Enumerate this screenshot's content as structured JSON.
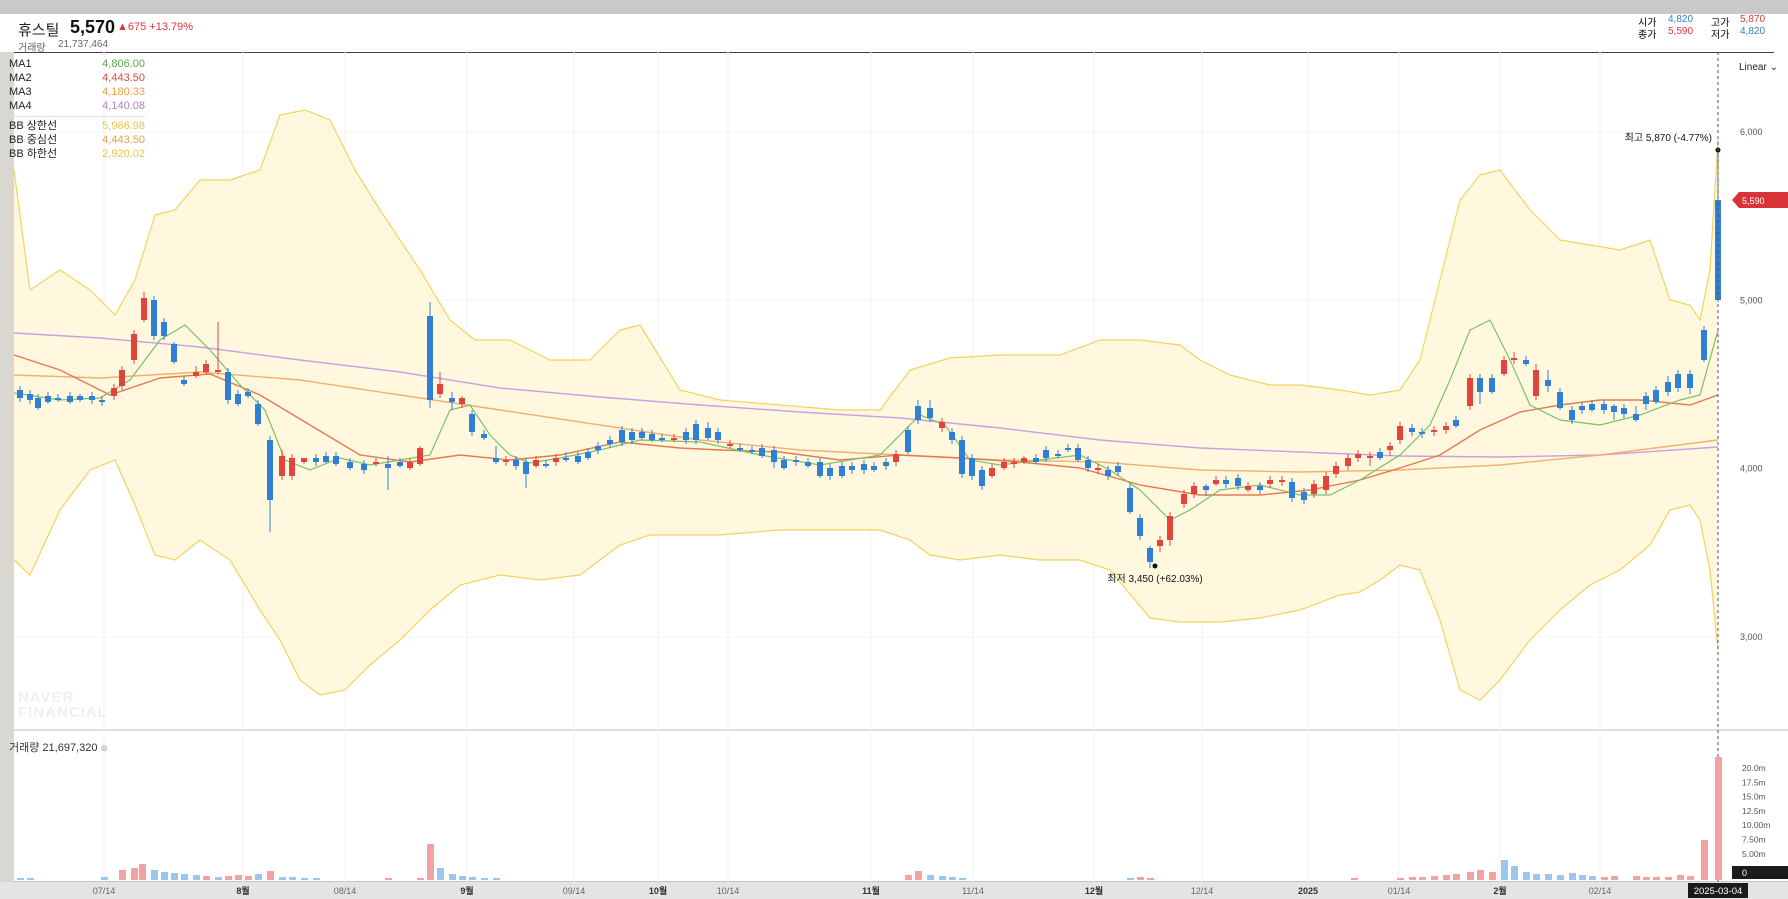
{
  "stock": {
    "name": "휴스틸",
    "price": "5,570",
    "change": "▲675 +13.79%",
    "volume_label": "거래량",
    "volume": "21,737,464"
  },
  "ohlc": {
    "open_label": "시가",
    "open": "4,820",
    "high_label": "고가",
    "high": "5,870",
    "close_label": "종가",
    "close": "5,590",
    "low_label": "저가",
    "low": "4,820"
  },
  "legend": {
    "ma": [
      {
        "name": "MA1",
        "value": "4,806.00",
        "color": "#5aaa4e"
      },
      {
        "name": "MA2",
        "value": "4,443.50",
        "color": "#e04848"
      },
      {
        "name": "MA3",
        "value": "4,180.33",
        "color": "#f0a040"
      },
      {
        "name": "MA4",
        "value": "4,140.08",
        "color": "#b080d0"
      }
    ],
    "bb": [
      {
        "name": "BB 상한선",
        "value": "5,966.98",
        "color": "#e8c54a"
      },
      {
        "name": "BB 중심선",
        "value": "4,443.50",
        "color": "#e8a040"
      },
      {
        "name": "BB 하한선",
        "value": "2,920.02",
        "color": "#e8c54a"
      }
    ]
  },
  "scale_mode": "Linear",
  "watermark": [
    "NAVER",
    "FINANCIAL"
  ],
  "volume_pane": {
    "label": "거래량 21,697,320"
  },
  "annotations": {
    "high": "최고 5,870 (-4.77%)",
    "low": "최저 3,450 (+62.03%)"
  },
  "current_date": "2025-03-04",
  "current_volume_label": "0",
  "chart_data": {
    "type": "candlestick",
    "y_ticks": [
      "6,000",
      "5,000",
      "4,000",
      "3,000"
    ],
    "volume_ticks": [
      "20.0m",
      "17.5m",
      "15.0m",
      "12.5m",
      "10.00m",
      "7.50m",
      "5.00m"
    ],
    "x_labels": [
      "07/14",
      "8월",
      "08/14",
      "9월",
      "09/14",
      "10월",
      "10/14",
      "11월",
      "11/14",
      "12월",
      "12/14",
      "2025",
      "01/14",
      "2월",
      "02/14"
    ],
    "current_price_tag": "5,590",
    "colors": {
      "up": "#e0443c",
      "down": "#2f7fd6",
      "band_fill": "#fff8df",
      "band_line": "#f3d35c"
    }
  }
}
